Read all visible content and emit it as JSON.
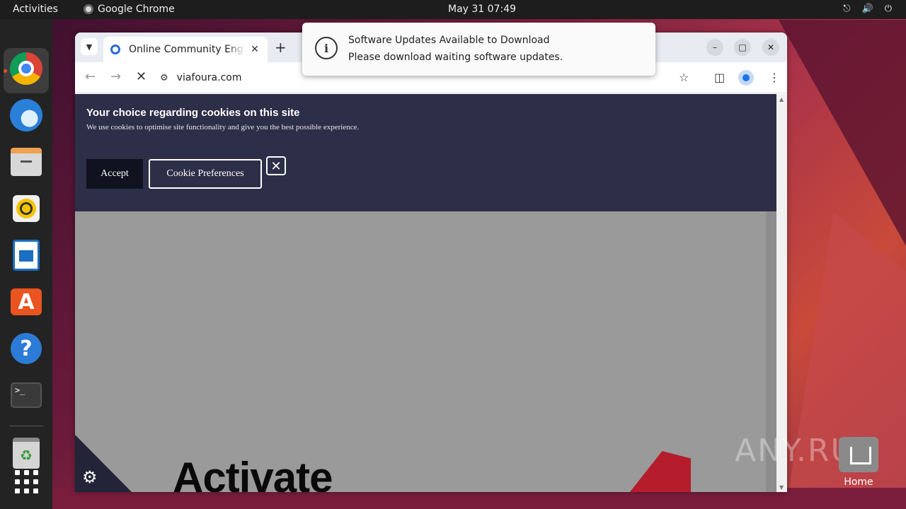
{
  "topbar": {
    "activities": "Activities",
    "app_name": "Google Chrome",
    "clock": "May 31  07:49",
    "tray_icons": [
      "network-icon",
      "volume-icon",
      "power-icon"
    ]
  },
  "dock": {
    "items": [
      "chrome-icon",
      "thunderbird-icon",
      "files-icon",
      "rhythmbox-icon",
      "writer-icon",
      "app-center-icon",
      "help-icon",
      "terminal-icon",
      "trash-icon",
      "show-apps-icon"
    ],
    "accent": "#e95420"
  },
  "browser": {
    "tab_title": "Online Community Engagement",
    "tab_close": "✕",
    "new_tab": "+",
    "url": "viafoura.com",
    "window_controls": {
      "minimize": "–",
      "maximize": "□",
      "close": "✕"
    }
  },
  "cookie_banner": {
    "title": "Your choice regarding cookies on this site",
    "text": "We use cookies to optimise site functionality and give you the best possible experience.",
    "accept_label": "Accept",
    "prefs_label": "Cookie Preferences",
    "close_label": "✕",
    "bg_color": "#2d2e48"
  },
  "page": {
    "headline": "Activate",
    "accent_red": "#b51c2c"
  },
  "notification": {
    "title": "Software Updates Available to Download",
    "body": "Please download waiting software updates."
  },
  "desktop": {
    "home_label": "Home",
    "watermark": "ANY.RUN"
  }
}
